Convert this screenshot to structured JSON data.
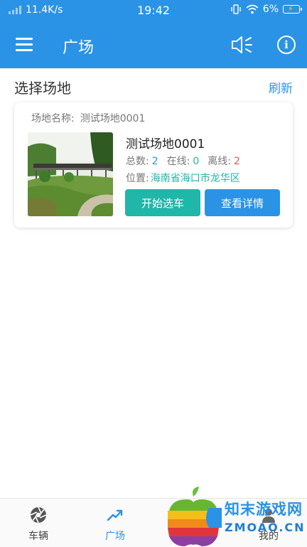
{
  "status_bar": {
    "speed": "11.4K/s",
    "time": "19:42",
    "battery": "6%"
  },
  "app_bar": {
    "title": "广场",
    "menu_icon": "menu-icon",
    "speaker_icon": "speaker-icon",
    "info_icon": "info-icon"
  },
  "section": {
    "title": "选择场地",
    "refresh": "刷新"
  },
  "venue": {
    "name_label": "场地名称:",
    "name": "测试场地0001",
    "title": "测试场地0001",
    "total_label": "总数:",
    "total": "2",
    "online_label": "在线:",
    "online": "0",
    "offline_label": "离线:",
    "offline": "2",
    "location_label": "位置:",
    "location": "海南省海口市龙华区",
    "start_button": "开始选车",
    "detail_button": "查看详情"
  },
  "tabs": [
    {
      "label": "车辆",
      "icon": "aperture-icon"
    },
    {
      "label": "广场",
      "icon": "trend-icon",
      "active": true
    },
    {
      "label": "",
      "icon": ""
    },
    {
      "label": "我的",
      "icon": "user-icon"
    }
  ],
  "watermark": {
    "line1": "知末游戏网",
    "line2": "ZMOAO.CN"
  },
  "colors": {
    "primary": "#2a93e6",
    "teal": "#20b6a8",
    "red": "#e6544f"
  }
}
